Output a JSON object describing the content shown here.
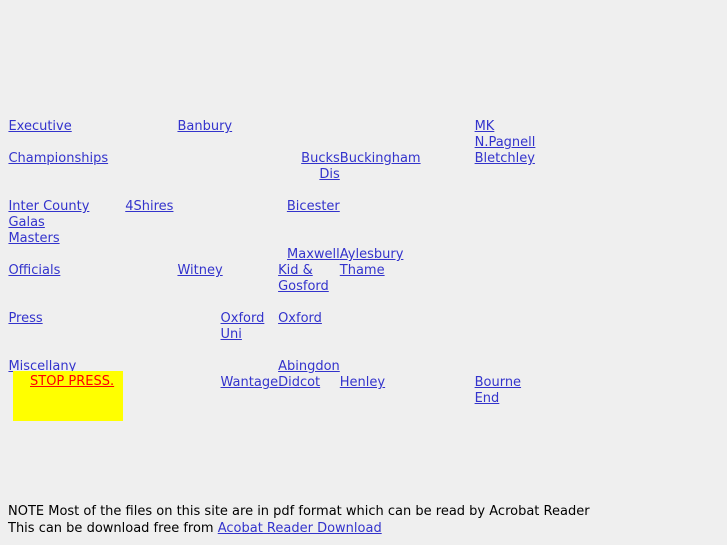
{
  "page": {
    "background_color": "#efefef",
    "link_color": "#3333cc",
    "stoppress_text_color": "#ff0000",
    "stoppress_background_color": "#ffff00"
  },
  "sections": {
    "left_nav": [
      {
        "label": "Executive"
      },
      {
        "label": "Championships"
      },
      {
        "label": "Inter County Galas"
      },
      {
        "label": "Masters"
      },
      {
        "label": "Officials"
      },
      {
        "label": "Press"
      },
      {
        "label": "Miscellany"
      }
    ],
    "clubs": [
      {
        "label": "Banbury"
      },
      {
        "label": "MK"
      },
      {
        "label": "N.Pagnell"
      },
      {
        "label": "Bucks Dis"
      },
      {
        "label": "Buckingham"
      },
      {
        "label": "Bletchley"
      },
      {
        "label": "4Shires"
      },
      {
        "label": "Bicester"
      },
      {
        "label": "Maxwell"
      },
      {
        "label": "Aylesbury"
      },
      {
        "label": "Witney"
      },
      {
        "label": "Kid & Gosford"
      },
      {
        "label": "Thame"
      },
      {
        "label": "Oxford Uni"
      },
      {
        "label": "Oxford"
      },
      {
        "label": "Abingdon"
      },
      {
        "label": "Wantage"
      },
      {
        "label": "Didcot"
      },
      {
        "label": "Henley"
      },
      {
        "label": "Bourne End"
      }
    ]
  },
  "stop_press": {
    "label": "STOP PRESS."
  },
  "footer": {
    "line1": "NOTE Most of the files on this site are in pdf format which can be read by Acrobat Reader",
    "line2_prefix": "This can be download free from ",
    "link_label": "Acobat Reader Download"
  }
}
